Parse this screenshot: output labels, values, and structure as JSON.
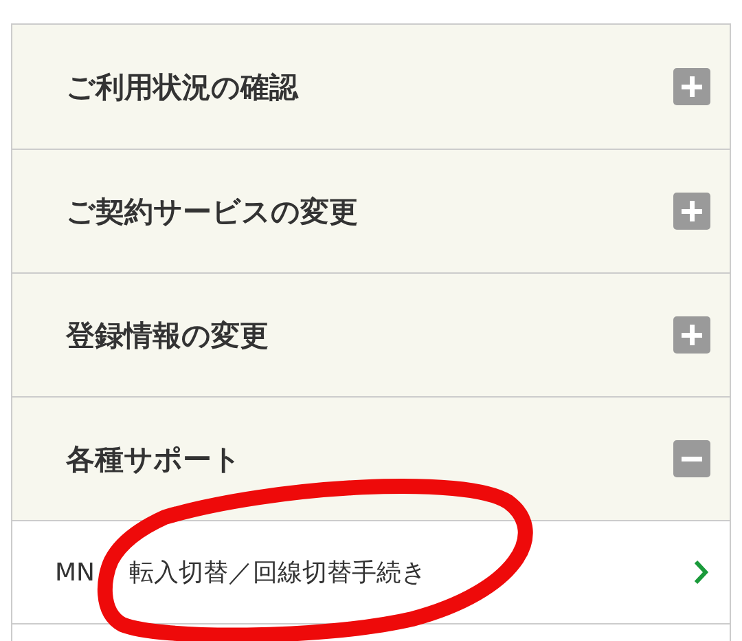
{
  "sections": [
    {
      "title": "ご利用状況の確認",
      "expanded": false
    },
    {
      "title": "ご契約サービスの変更",
      "expanded": false
    },
    {
      "title": "登録情報の変更",
      "expanded": false
    },
    {
      "title": "各種サポート",
      "expanded": true,
      "items": [
        {
          "label_start": "MN",
          "label": "転入切替／回線切替手続き"
        }
      ]
    }
  ]
}
